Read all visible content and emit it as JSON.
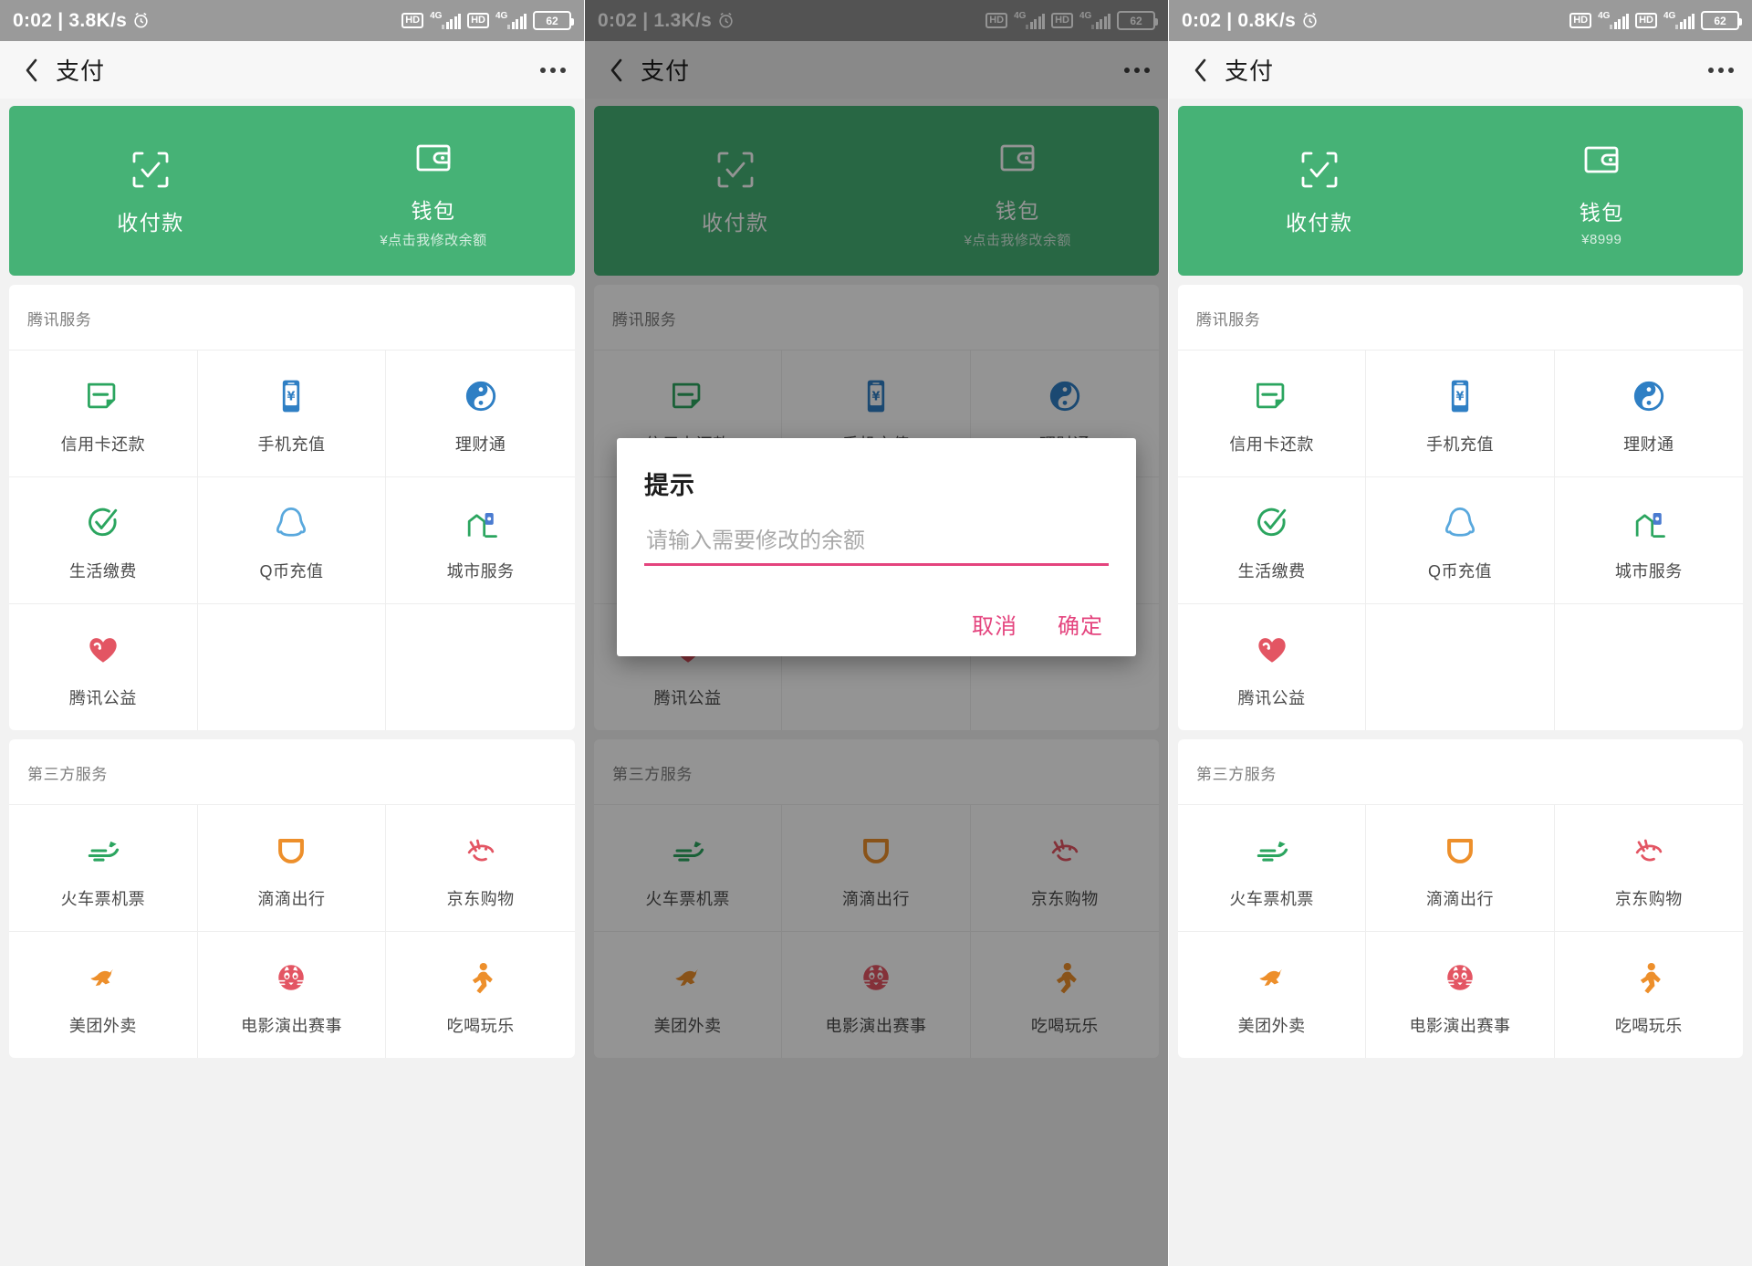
{
  "app": {
    "title": "支付"
  },
  "panels": [
    {
      "id": "panel-default",
      "statusbar": {
        "time": "0:02",
        "net_speed": "3.8K/s",
        "battery": "62",
        "signal_label": "4G",
        "hd_label": "HD"
      },
      "wallet_sub": "¥点击我修改余额",
      "dimmed": false,
      "dialog_visible": false
    },
    {
      "id": "panel-dialog",
      "statusbar": {
        "time": "0:02",
        "net_speed": "1.3K/s",
        "battery": "62",
        "signal_label": "4G",
        "hd_label": "HD"
      },
      "wallet_sub": "¥点击我修改余额",
      "dimmed": true,
      "dialog_visible": true
    },
    {
      "id": "panel-updated",
      "statusbar": {
        "time": "0:02",
        "net_speed": "0.8K/s",
        "battery": "62",
        "signal_label": "4G",
        "hd_label": "HD"
      },
      "wallet_sub": "¥8999",
      "dimmed": false,
      "dialog_visible": false
    }
  ],
  "navbar": {
    "back_icon": "chevron-left-icon",
    "title": "支付",
    "more_icon": "more-horizontal-icon"
  },
  "green_card": {
    "scan": {
      "icon": "scan-pay-icon",
      "label": "收付款"
    },
    "wallet": {
      "icon": "wallet-icon",
      "label": "钱包"
    }
  },
  "sections": [
    {
      "title": "腾讯服务",
      "items": [
        {
          "label": "信用卡还款",
          "icon": "credit-card-repay-icon",
          "color": "#2ba55f"
        },
        {
          "label": "手机充值",
          "icon": "mobile-topup-icon",
          "color": "#2f7fc4"
        },
        {
          "label": "理财通",
          "icon": "licaitong-icon",
          "color": "#2f7fc4"
        },
        {
          "label": "生活缴费",
          "icon": "utility-bill-icon",
          "color": "#2ba55f"
        },
        {
          "label": "Q币充值",
          "icon": "qq-coin-icon",
          "color": "#59a8dd"
        },
        {
          "label": "城市服务",
          "icon": "city-service-icon",
          "color": "#2ba55f"
        },
        {
          "label": "腾讯公益",
          "icon": "charity-heart-icon",
          "color": "#e35563"
        }
      ]
    },
    {
      "title": "第三方服务",
      "items": [
        {
          "label": "火车票机票",
          "icon": "train-plane-icon",
          "color": "#2ba55f"
        },
        {
          "label": "滴滴出行",
          "icon": "didi-icon",
          "color": "#ed8f2b"
        },
        {
          "label": "京东购物",
          "icon": "jd-dog-icon",
          "color": "#e35563"
        },
        {
          "label": "美团外卖",
          "icon": "meituan-kangaroo-icon",
          "color": "#ed8f2b"
        },
        {
          "label": "电影演出赛事",
          "icon": "maoyan-cat-icon",
          "color": "#e35563"
        },
        {
          "label": "吃喝玩乐",
          "icon": "dianping-runner-icon",
          "color": "#ed8f2b"
        }
      ]
    }
  ],
  "dialog": {
    "title": "提示",
    "input_value": "",
    "input_placeholder": "请输入需要修改的余额",
    "cancel_label": "取消",
    "confirm_label": "确定",
    "accent_color": "#e4447e"
  },
  "colors": {
    "green": "#46b276",
    "status_bar": "#9a9a9a",
    "page_bg": "#f2f2f2",
    "nav_bg": "#f7f7f7"
  }
}
